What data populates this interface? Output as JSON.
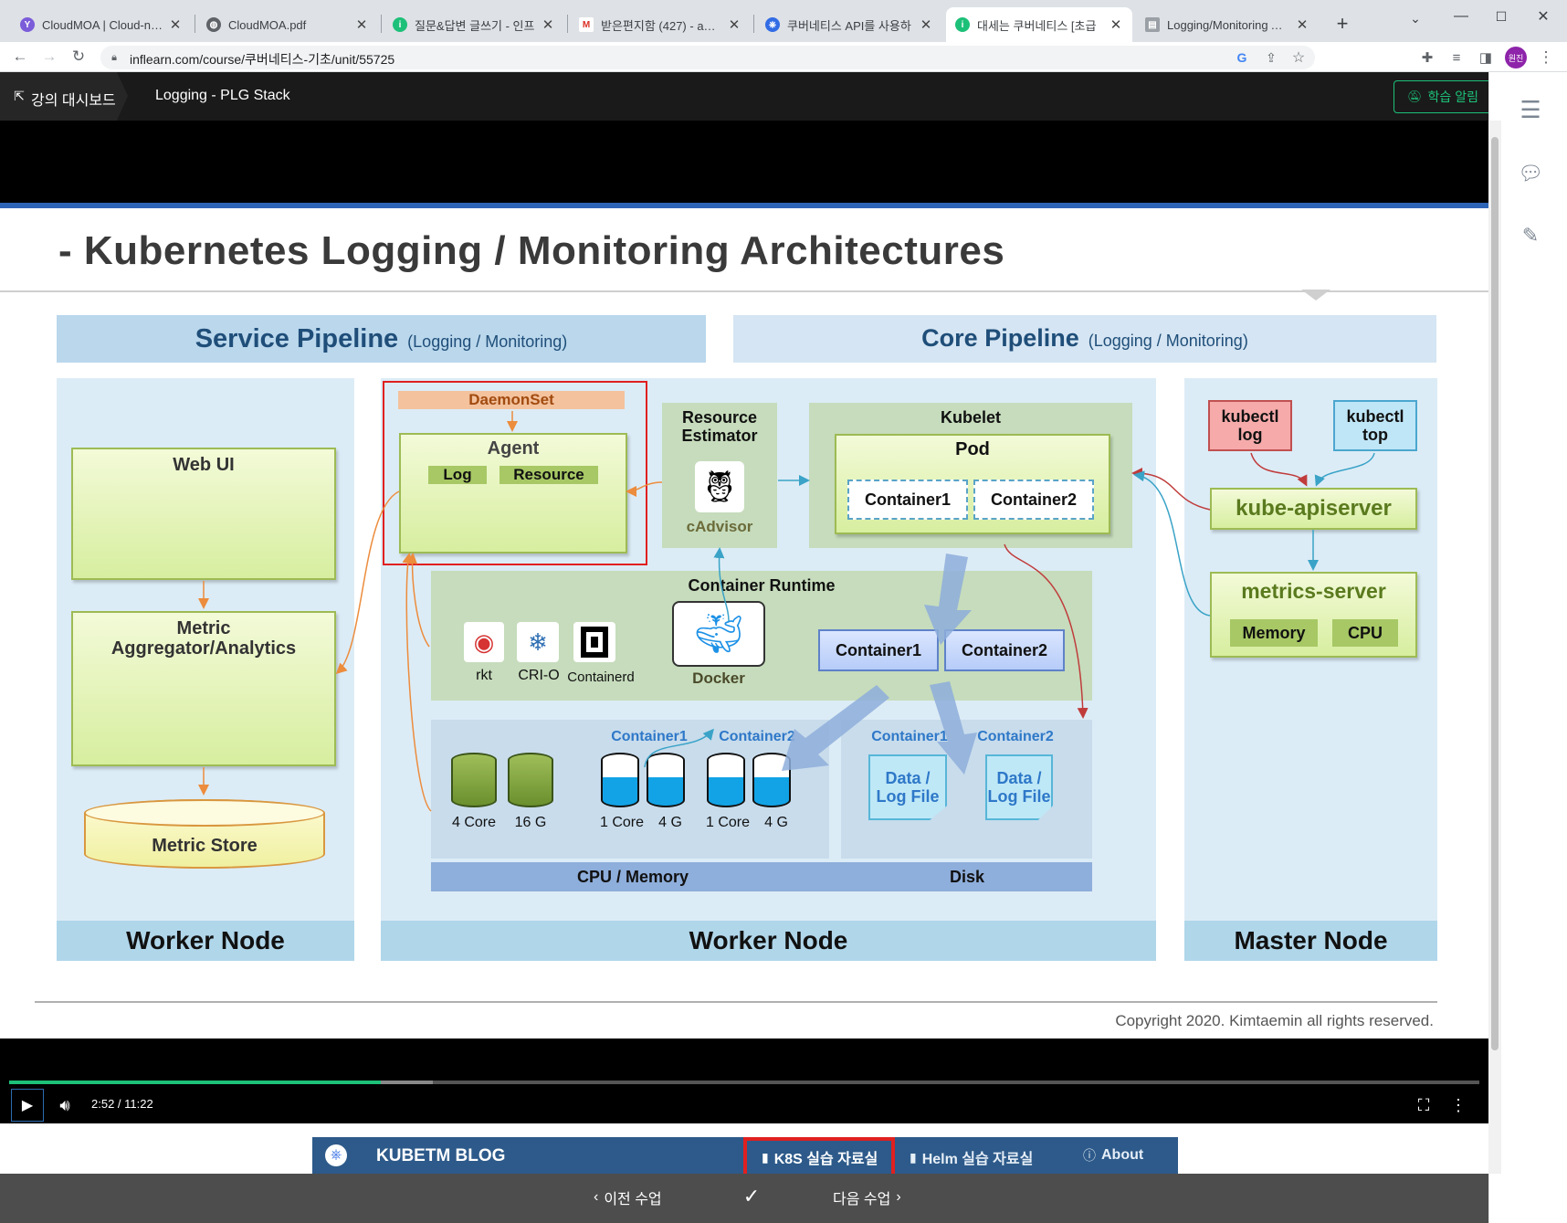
{
  "browser": {
    "tabs": [
      {
        "title": "CloudMOA | Cloud-native",
        "icon": "cloudmoa-icon"
      },
      {
        "title": "CloudMOA.pdf",
        "icon": "globe-icon"
      },
      {
        "title": "질문&답변 글쓰기 - 인프",
        "icon": "inflearn-icon"
      },
      {
        "title": "받은편지함 (427) - acezzi",
        "icon": "gmail-icon"
      },
      {
        "title": "쿠버네티스 API를 사용하",
        "icon": "kubernetes-icon"
      },
      {
        "title": "대세는 쿠버네티스 [초급",
        "icon": "inflearn-icon"
      },
      {
        "title": "Logging/Monitoring Arch",
        "icon": "doc-icon"
      }
    ],
    "active_tab": 5,
    "url": "inflearn.com/course/쿠버네티스-기초/unit/55725",
    "profile": "원진"
  },
  "site": {
    "dashboard_label": "강의 대시보드",
    "lecture_title": "Logging - PLG Stack",
    "notify_label": "학습 알림"
  },
  "slide": {
    "title": "- Kubernetes Logging / Monitoring Architectures",
    "service_pipeline": "Service Pipeline",
    "service_sub": "(Logging / Monitoring)",
    "core_pipeline": "Core Pipeline",
    "core_sub": "(Logging / Monitoring)",
    "web_ui": "Web UI",
    "metric_agg": "Metric Aggregator/Analytics",
    "metric_store": "Metric Store",
    "daemonset": "DaemonSet",
    "agent": "Agent",
    "log": "Log",
    "resource": "Resource",
    "resource_estimator": "Resource Estimator",
    "cadvisor": "cAdvisor",
    "kubelet": "Kubelet",
    "pod": "Pod",
    "container1": "Container1",
    "container2": "Container2",
    "container_runtime": "Container Runtime",
    "rkt": "rkt",
    "crio": "CRI-O",
    "containerd": "Containerd",
    "docker": "Docker",
    "kubectl_log": "kubectl log",
    "kubectl_top": "kubectl top",
    "kube_apiserver": "kube-apiserver",
    "metrics_server": "metrics-server",
    "memory": "Memory",
    "cpu": "CPU",
    "c4core": "4 Core",
    "c16g": "16 G",
    "c1core_a": "1 Core",
    "c4g_a": "4 G",
    "c1core_b": "1 Core",
    "c4g_b": "4 G",
    "data_log_file": "Data / Log File",
    "cpu_memory": "CPU / Memory",
    "disk": "Disk",
    "worker_node": "Worker Node",
    "master_node": "Master Node",
    "copyright": "Copyright 2020. Kimtaemin all rights reserved."
  },
  "player": {
    "time": "2:52 / 11:22",
    "progress": 0.253,
    "buffered": 0.288
  },
  "blog": {
    "name": "KUBETM BLOG",
    "k8s": "K8S 실습 자료실",
    "helm": "Helm 실습 자료실",
    "about": "About"
  },
  "bottom": {
    "prev": "이전 수업",
    "next": "다음 수업"
  },
  "colors": {
    "accent": "#2e64b5",
    "green": "#1dc078",
    "highlight": "#e02020"
  }
}
